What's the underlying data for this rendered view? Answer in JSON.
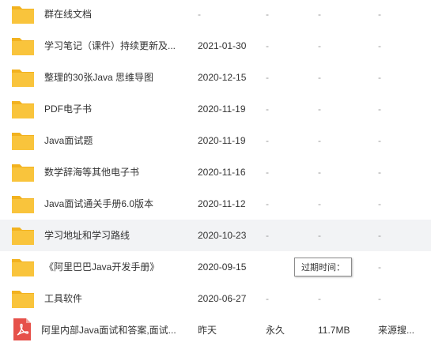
{
  "files": [
    {
      "name": "群在线文档",
      "date": "-",
      "expire": "-",
      "size": "-",
      "source": "-",
      "type": "folder"
    },
    {
      "name": "学习笔记（课件）持续更新及...",
      "date": "2021-01-30",
      "expire": "-",
      "size": "-",
      "source": "-",
      "type": "folder"
    },
    {
      "name": "整理的30张Java 思维导图",
      "date": "2020-12-15",
      "expire": "-",
      "size": "-",
      "source": "-",
      "type": "folder"
    },
    {
      "name": "PDF电子书",
      "date": "2020-11-19",
      "expire": "-",
      "size": "-",
      "source": "-",
      "type": "folder"
    },
    {
      "name": "Java面试题",
      "date": "2020-11-19",
      "expire": "-",
      "size": "-",
      "source": "-",
      "type": "folder"
    },
    {
      "name": "数学辞海等其他电子书",
      "date": "2020-11-16",
      "expire": "-",
      "size": "-",
      "source": "-",
      "type": "folder"
    },
    {
      "name": "Java面试通关手册6.0版本",
      "date": "2020-11-12",
      "expire": "-",
      "size": "-",
      "source": "-",
      "type": "folder"
    },
    {
      "name": "学习地址和学习路线",
      "date": "2020-10-23",
      "expire": "-",
      "size": "-",
      "source": "-",
      "type": "folder"
    },
    {
      "name": "《阿里巴巴Java开发手册》",
      "date": "2020-09-15",
      "expire": "-",
      "size": "-",
      "source": "-",
      "type": "folder"
    },
    {
      "name": "工具软件",
      "date": "2020-06-27",
      "expire": "-",
      "size": "-",
      "source": "-",
      "type": "folder"
    },
    {
      "name": "阿里内部Java面试和答案,面试...",
      "date": "昨天",
      "expire": "永久",
      "size": "11.7MB",
      "source": "来源搜...",
      "type": "pdf"
    }
  ],
  "tooltip": {
    "text": "过期时间："
  },
  "colors": {
    "folder": "#f9c43c",
    "folder_dark": "#f2b21f",
    "pdf": "#e6514a",
    "hover": "#f2f3f5"
  }
}
